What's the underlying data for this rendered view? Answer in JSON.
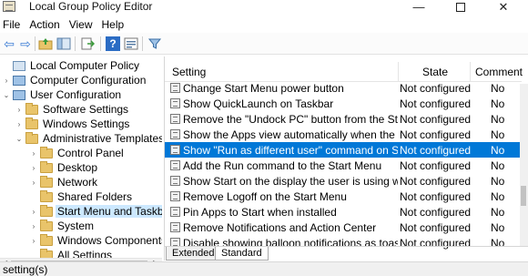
{
  "window": {
    "title": "Local Group Policy Editor",
    "minimize_glyph": "—",
    "close_glyph": "✕"
  },
  "menu": [
    "File",
    "Action",
    "View",
    "Help"
  ],
  "toolbar": {
    "icons": [
      "back-arrow-icon",
      "forward-arrow-icon",
      "up-folder-icon",
      "show-hide-tree-icon",
      "export-list-icon",
      "help-icon",
      "properties-icon",
      "filter-icon"
    ],
    "glyphs": {
      "back": "⇦",
      "forward": "⇨",
      "help": "?",
      "filter": "⧩"
    }
  },
  "tree": {
    "items": [
      {
        "label": "Local Computer Policy",
        "level": 0,
        "expander": ""
      },
      {
        "label": "Computer Configuration",
        "level": 1,
        "expander": "›"
      },
      {
        "label": "User Configuration",
        "level": 1,
        "expander": "⌄"
      },
      {
        "label": "Software Settings",
        "level": 2,
        "expander": "›"
      },
      {
        "label": "Windows Settings",
        "level": 2,
        "expander": "›"
      },
      {
        "label": "Administrative Templates",
        "level": 2,
        "expander": "⌄"
      },
      {
        "label": "Control Panel",
        "level": 3,
        "expander": "›"
      },
      {
        "label": "Desktop",
        "level": 3,
        "expander": "›"
      },
      {
        "label": "Network",
        "level": 3,
        "expander": "›"
      },
      {
        "label": "Shared Folders",
        "level": 3,
        "expander": ""
      },
      {
        "label": "Start Menu and Taskbar",
        "level": 3,
        "expander": "›"
      },
      {
        "label": "System",
        "level": 3,
        "expander": "›"
      },
      {
        "label": "Windows Components",
        "level": 3,
        "expander": "›"
      },
      {
        "label": "All Settings",
        "level": 3,
        "expander": ""
      }
    ],
    "selected_index": 10
  },
  "list": {
    "columns": {
      "setting": "Setting",
      "state": "State",
      "comment": "Comment"
    },
    "rows": [
      {
        "setting": "Change Start Menu power button",
        "state": "Not configured",
        "comment": "No"
      },
      {
        "setting": "Show QuickLaunch on Taskbar",
        "state": "Not configured",
        "comment": "No"
      },
      {
        "setting": "Remove the \"Undock PC\" button from the Start ...",
        "state": "Not configured",
        "comment": "No"
      },
      {
        "setting": "Show the Apps view automatically when the user...",
        "state": "Not configured",
        "comment": "No"
      },
      {
        "setting": "Show \"Run as different user\" command on Start",
        "state": "Not configured",
        "comment": "No"
      },
      {
        "setting": "Add the Run command to the Start Menu",
        "state": "Not configured",
        "comment": "No"
      },
      {
        "setting": "Show Start on the display the user is using when ...",
        "state": "Not configured",
        "comment": "No"
      },
      {
        "setting": "Remove Logoff on the Start Menu",
        "state": "Not configured",
        "comment": "No"
      },
      {
        "setting": "Pin Apps to Start when installed",
        "state": "Not configured",
        "comment": "No"
      },
      {
        "setting": "Remove Notifications and Action Center",
        "state": "Not configured",
        "comment": "No"
      },
      {
        "setting": "Disable showing balloon notifications as toasts.",
        "state": "Not configured",
        "comment": "No"
      }
    ],
    "selected_index": 4
  },
  "tabs": [
    "Extended",
    "Standard"
  ],
  "active_tab": "Standard",
  "status": "setting(s)",
  "colors": {
    "selection": "#0078d7",
    "tree_selection": "#cce8ff"
  }
}
